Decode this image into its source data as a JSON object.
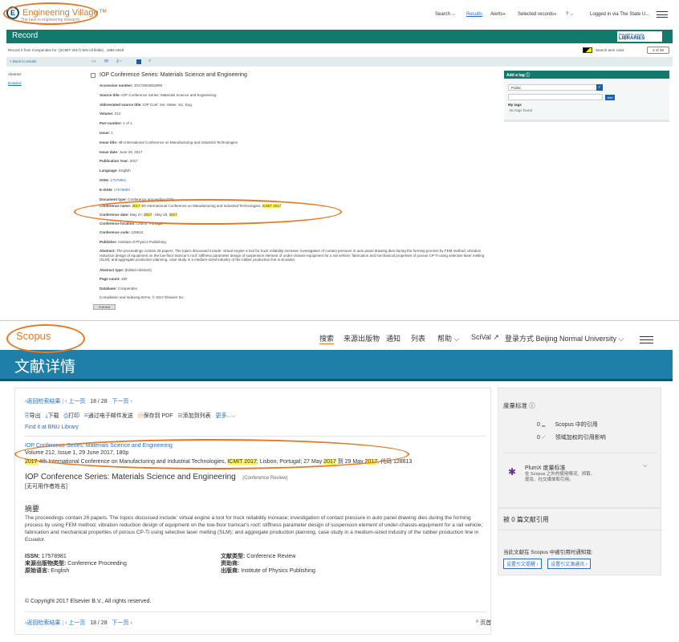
{
  "ev": {
    "logo_mark": "E",
    "logo_text": "Engineering Village™",
    "logo_sub": "The best in engineering research",
    "nav": [
      "Search ⌵",
      "Results",
      "Alerts",
      "Selected records",
      "? ⌵",
      "Logged in via The State U..."
    ],
    "record_title": "Record",
    "lib_top": "Brought to you by",
    "lib_name": "LIBRARIES",
    "crumb": "Record 2 from Compendex for: ((ICMIT 2017) WN All fields) , 1884-2018",
    "search_term_color": "Search term color",
    "pager": "2 of 28",
    "back": "< Back to results",
    "side": [
      "Abstract",
      "Detailed"
    ],
    "title": "IOP Conference Series: Materials Science and Engineering",
    "fields": [
      {
        "label": "Accession number:",
        "value": "20172603553990"
      },
      {
        "label": "Source title:",
        "value": "IOP Conference Series: Materials Science and Engineering"
      },
      {
        "label": "Abbreviated source title:",
        "value": "IOP Conf. Ser. Mater. Sci. Eng."
      },
      {
        "label": "Volume:",
        "value": "212"
      },
      {
        "label": "Part number:",
        "value": "1 of 1"
      },
      {
        "label": "Issue:",
        "value": "1"
      },
      {
        "label": "Issue title:",
        "value": "4th International Conference on Manufacturing and Industrial Technologies"
      },
      {
        "label": "Issue date:",
        "value": "June 29, 2017"
      },
      {
        "label": "Publication Year:",
        "value": "2017"
      },
      {
        "label": "Language:",
        "value": "English"
      },
      {
        "label": "ISSN:",
        "value": "17578981"
      },
      {
        "label": "E-ISSN:",
        "value": "1757899X"
      },
      {
        "label": "Document type:",
        "value": "Conference proceeding (CP)"
      }
    ],
    "conf_name_label": "Conference name:",
    "conf_name_a": "2017",
    "conf_name_b": " 4th International Conference on Manufacturing and Industrial Technologies, ",
    "conf_name_c": "ICMIT 2017",
    "conf_date_label": "Conference date:",
    "conf_date_a": "May 27, ",
    "conf_date_b": "2017",
    "conf_date_c": " - May 29, ",
    "conf_date_d": "2017",
    "conf_loc_label": "Conference location:",
    "conf_loc": "Lisbon, Portugal",
    "fields2": [
      {
        "label": "Conference code:",
        "value": "128613"
      },
      {
        "label": "Publisher:",
        "value": "Institute of Physics Publishing"
      }
    ],
    "abstract_label": "Abstract:",
    "abstract": "The proceedings contain 26 papers. The topics discussed include: virtual engine a tool for truck reliability increase; investigation of contact pressure in auto panel drawing dies during the forming process by FEM method; vibration reduction design of equipment on the low-floor tramcar's roof; stiffness parameter design of suspension element of under-chassis-equipment for a rail vehicle; fabrication and mechanical properties of porous CP-Ti using selective laser melting (SLM); and aggregate production planning, case study in a medium-sized industry of the rubber production line in Ecuador.",
    "fields3": [
      {
        "label": "Abstract type:",
        "value": "(Edited Abstract)"
      },
      {
        "label": "Page count:",
        "value": "180"
      },
      {
        "label": "Database:",
        "value": "Compendex"
      }
    ],
    "copyright": "Compilation and indexing terms, © 2017 Elsevier Inc.",
    "fulltext_btn": "Full text",
    "tag_head": "Add a tag ⓘ",
    "tag_select": "Public",
    "tag_add": "Add",
    "my_tags": "My tags",
    "no_tags": "No tags found"
  },
  "sc": {
    "logo": "Scopus",
    "nav": [
      "搜索",
      "来源出版物",
      "通知",
      "列表",
      "帮助 ⌵",
      "SciVal ↗",
      "登录方式 Beijing Normal University ⌵"
    ],
    "hero": "文献详情",
    "back_results": "‹返回检索结果",
    "prev": "‹ 上一页",
    "pos": "18 / 28",
    "next": "下一页 ›",
    "actions": [
      "导出",
      "下载",
      "打印",
      "通过电子邮件发送",
      "保存到 PDF",
      "添加到列表",
      "更多...⌵"
    ],
    "find_it": "Find it at BNU Library",
    "src_link": "IOP Conference Series: Materials Science and Engineering",
    "vol_line": "Volume 212, Issue 1, 29 June 2017, 180p",
    "conf_a": "2017",
    "conf_b": " 4th International Conference on Manufacturing and Industrial Technologies, ",
    "conf_c": "ICMIT 2017",
    "conf_d": "; Lisbon; Portugal; 27 May ",
    "conf_e": "2017",
    "conf_f": " 到 29 May ",
    "conf_g": "2017",
    "conf_h": "; 代码 128613",
    "title": "IOP Conference Series: Materials Science and Engineering",
    "title_type": "(Conference Review)",
    "no_author": "[无可用作者姓名]",
    "abstract_head": "摘要",
    "abstract": "The proceedings contain 26 papers. The topics discussed include: virtual engine a tool for truck reliability increase; investigation of contact pressure in auto panel drawing dies during the forming process by using FEM method; vibration reduction design of equipment on the low-floor tramcar's roof; stiffness parameter design of suspension element of under-chassis-equipment for a rail vehicle; fabrication and mechanical properties of porous CP-Ti using selective laser melting (SLM); and aggregate production planning, case study in a medium-sized industry of the rubber production line in Ecuador.",
    "meta_left": [
      {
        "label": "ISSN:",
        "value": "17578981"
      },
      {
        "label": "来源出版物类型:",
        "value": "Conference Proceeding"
      },
      {
        "label": "原始语言:",
        "value": "English"
      }
    ],
    "meta_right": [
      {
        "label": "文献类型:",
        "value": "Conference Review"
      },
      {
        "label": "资助商:",
        "value": ""
      },
      {
        "label": "出版商:",
        "value": "Institute of Physics Publishing"
      }
    ],
    "copyright": "© Copyright 2017 Elsevier B.V., All rights reserved.",
    "top": "^ 页首",
    "metrics_head": "度量标准 ⓘ",
    "cites_n": "0",
    "cites_label": "Scopus 中的引用",
    "fwci_n": "0",
    "fwci_label": "领域加权的引用影响",
    "plumx": "PlumX 度量标准",
    "plumx_desc": "在 Scopus 之外的使用情况、抓取、提及、社交媒体和引用。",
    "cited_head": "被 0 篇文献引用",
    "notify": "当此文献在 Scopus 中被引用时通知我:",
    "alert1": "设置引文提醒 ›",
    "alert2": "设置引文源通讯 ›"
  }
}
